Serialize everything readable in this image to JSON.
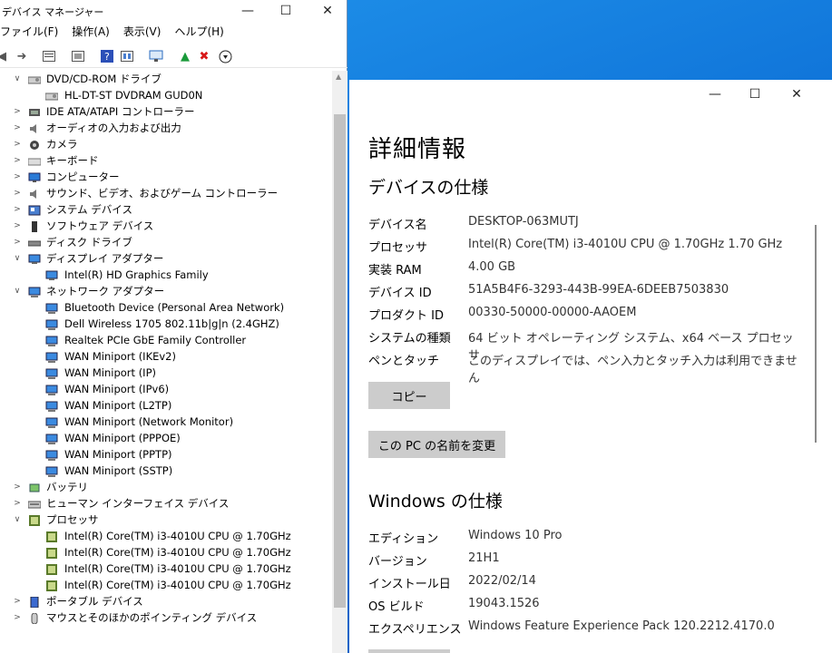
{
  "device_manager": {
    "title": "デバイス マネージャー",
    "menu": [
      "ファイル(F)",
      "操作(A)",
      "表示(V)",
      "ヘルプ(H)"
    ],
    "tree": [
      {
        "level": 0,
        "expanded": true,
        "icon": "dvd-icon",
        "label": "DVD/CD-ROM ドライブ"
      },
      {
        "level": 1,
        "icon": "dvd-drive-icon",
        "label": "HL-DT-ST DVDRAM GUD0N"
      },
      {
        "level": 0,
        "expanded": false,
        "icon": "ide-icon",
        "label": "IDE ATA/ATAPI コントローラー"
      },
      {
        "level": 0,
        "expanded": false,
        "icon": "speaker-icon",
        "label": "オーディオの入力および出力"
      },
      {
        "level": 0,
        "expanded": false,
        "icon": "camera-icon",
        "label": "カメラ"
      },
      {
        "level": 0,
        "expanded": false,
        "icon": "keyboard-icon",
        "label": "キーボード"
      },
      {
        "level": 0,
        "expanded": false,
        "icon": "computer-icon",
        "label": "コンピューター"
      },
      {
        "level": 0,
        "expanded": false,
        "icon": "speaker-icon",
        "label": "サウンド、ビデオ、およびゲーム コントローラー"
      },
      {
        "level": 0,
        "expanded": false,
        "icon": "system-device-icon",
        "label": "システム デバイス"
      },
      {
        "level": 0,
        "expanded": false,
        "icon": "software-device-icon",
        "label": "ソフトウェア デバイス"
      },
      {
        "level": 0,
        "expanded": false,
        "icon": "disk-drive-icon",
        "label": "ディスク ドライブ"
      },
      {
        "level": 0,
        "expanded": true,
        "icon": "display-icon",
        "label": "ディスプレイ アダプター"
      },
      {
        "level": 1,
        "icon": "display-icon",
        "label": "Intel(R) HD Graphics Family"
      },
      {
        "level": 0,
        "expanded": true,
        "icon": "network-icon",
        "label": "ネットワーク アダプター"
      },
      {
        "level": 1,
        "icon": "network-icon",
        "label": "Bluetooth Device (Personal Area Network)"
      },
      {
        "level": 1,
        "icon": "network-icon",
        "label": "Dell Wireless 1705 802.11b|g|n (2.4GHZ)"
      },
      {
        "level": 1,
        "icon": "network-icon",
        "label": "Realtek PCIe GbE Family Controller"
      },
      {
        "level": 1,
        "icon": "network-icon",
        "label": "WAN Miniport (IKEv2)"
      },
      {
        "level": 1,
        "icon": "network-icon",
        "label": "WAN Miniport (IP)"
      },
      {
        "level": 1,
        "icon": "network-icon",
        "label": "WAN Miniport (IPv6)"
      },
      {
        "level": 1,
        "icon": "network-icon",
        "label": "WAN Miniport (L2TP)"
      },
      {
        "level": 1,
        "icon": "network-icon",
        "label": "WAN Miniport (Network Monitor)"
      },
      {
        "level": 1,
        "icon": "network-icon",
        "label": "WAN Miniport (PPPOE)"
      },
      {
        "level": 1,
        "icon": "network-icon",
        "label": "WAN Miniport (PPTP)"
      },
      {
        "level": 1,
        "icon": "network-icon",
        "label": "WAN Miniport (SSTP)"
      },
      {
        "level": 0,
        "expanded": false,
        "icon": "battery-icon",
        "label": "バッテリ"
      },
      {
        "level": 0,
        "expanded": false,
        "icon": "hid-icon",
        "label": "ヒューマン インターフェイス デバイス"
      },
      {
        "level": 0,
        "expanded": true,
        "icon": "processor-icon",
        "label": "プロセッサ"
      },
      {
        "level": 1,
        "icon": "processor-icon",
        "label": "Intel(R) Core(TM) i3-4010U CPU @ 1.70GHz"
      },
      {
        "level": 1,
        "icon": "processor-icon",
        "label": "Intel(R) Core(TM) i3-4010U CPU @ 1.70GHz"
      },
      {
        "level": 1,
        "icon": "processor-icon",
        "label": "Intel(R) Core(TM) i3-4010U CPU @ 1.70GHz"
      },
      {
        "level": 1,
        "icon": "processor-icon",
        "label": "Intel(R) Core(TM) i3-4010U CPU @ 1.70GHz"
      },
      {
        "level": 0,
        "expanded": false,
        "icon": "portable-device-icon",
        "label": "ポータブル デバイス"
      },
      {
        "level": 0,
        "expanded": false,
        "icon": "mouse-icon",
        "label": "マウスとそのほかのポインティング デバイス"
      }
    ]
  },
  "settings": {
    "page_title": "詳細情報",
    "device_spec_title": "デバイスの仕様",
    "device_spec": [
      {
        "k": "デバイス名",
        "v": "DESKTOP-063MUTJ"
      },
      {
        "k": "プロセッサ",
        "v": "Intel(R) Core(TM) i3-4010U CPU @ 1.70GHz   1.70 GHz"
      },
      {
        "k": "実装 RAM",
        "v": "4.00 GB"
      },
      {
        "k": "デバイス ID",
        "v": "51A5B4F6-3293-443B-99EA-6DEEB7503830"
      },
      {
        "k": "プロダクト ID",
        "v": "00330-50000-00000-AAOEM"
      },
      {
        "k": "システムの種類",
        "v": "64 ビット オペレーティング システム、x64 ベース プロセッサ"
      },
      {
        "k": "ペンとタッチ",
        "v": "このディスプレイでは、ペン入力とタッチ入力は利用できません"
      }
    ],
    "copy_button": "コピー",
    "rename_button": "この PC の名前を変更",
    "windows_spec_title": "Windows の仕様",
    "windows_spec": [
      {
        "k": "エディション",
        "v": "Windows 10 Pro"
      },
      {
        "k": "バージョン",
        "v": "21H1"
      },
      {
        "k": "インストール日",
        "v": "2022/02/14"
      },
      {
        "k": "OS ビルド",
        "v": "19043.1526"
      },
      {
        "k": "エクスペリエンス",
        "v": "Windows Feature Experience Pack 120.2212.4170.0"
      }
    ]
  }
}
